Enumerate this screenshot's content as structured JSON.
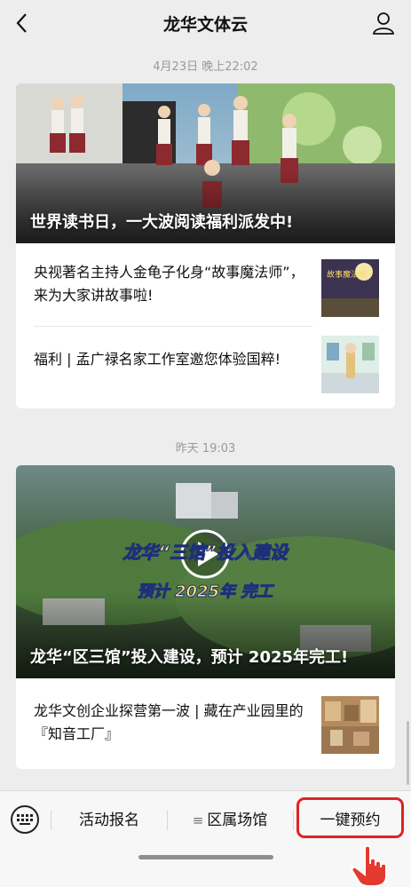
{
  "header": {
    "title": "龙华文体云"
  },
  "feed": [
    {
      "timestamp": "4月23日 晚上22:02",
      "hero_caption": "世界读书日，一大波阅读福利派发中!",
      "items": [
        {
          "title": "央视著名主持人金龟子化身“故事魔法师”，来为大家讲故事啦!",
          "thumb_text": "故事魔法师"
        },
        {
          "title": "福利 | 孟广禄名家工作室邀您体验国粹!",
          "thumb_text": ""
        }
      ]
    },
    {
      "timestamp": "昨天 19:03",
      "video_overlay_line1": "龙华“三馆”投入建设",
      "video_overlay_line2": "预计 2025年 完工",
      "hero_caption": "龙华“区三馆”投入建设，预计 2025年完工!",
      "items": [
        {
          "title": "龙华文创企业探营第一波 | 藏在产业园里的『知音工厂』"
        }
      ]
    }
  ],
  "bottom_menu": {
    "keyboard_icon": "keyboard-icon",
    "items": [
      {
        "label": "活动报名"
      },
      {
        "label": "区属场馆",
        "prefix": "≡"
      },
      {
        "label": "一键预约"
      }
    ]
  },
  "colors": {
    "highlight": "#e12222",
    "background": "#ededed"
  }
}
